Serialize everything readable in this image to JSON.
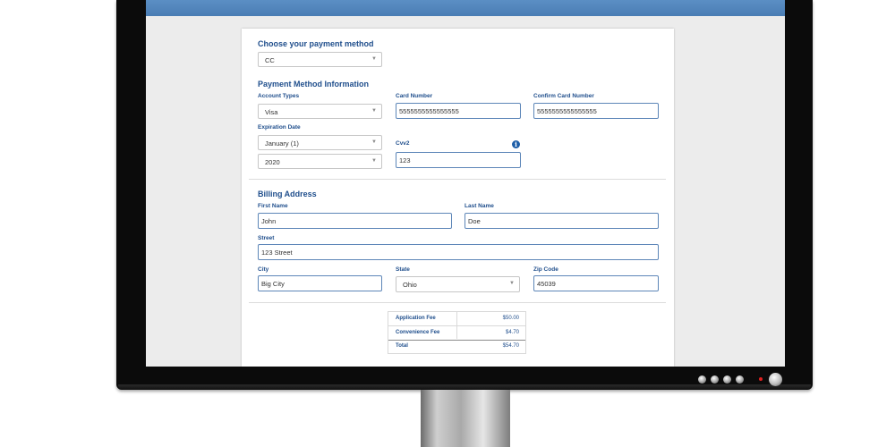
{
  "form": {
    "payment_method": {
      "heading": "Choose your payment method",
      "value": "CC"
    },
    "payment_info": {
      "heading": "Payment Method Information",
      "account_types": {
        "label": "Account Types",
        "value": "Visa"
      },
      "card_number": {
        "label": "Card Number",
        "value": "5555555555555555"
      },
      "confirm_card_number": {
        "label": "Confirm Card Number",
        "value": "5555555555555555"
      },
      "expiration": {
        "label": "Expiration Date",
        "month": "January (1)",
        "year": "2020"
      },
      "cvv": {
        "label": "Cvv2",
        "value": "123"
      }
    },
    "billing": {
      "heading": "Billing Address",
      "first_name": {
        "label": "First Name",
        "value": "John"
      },
      "last_name": {
        "label": "Last Name",
        "value": "Doe"
      },
      "street": {
        "label": "Street",
        "value": "123 Street"
      },
      "city": {
        "label": "City",
        "value": "Big City"
      },
      "state": {
        "label": "State",
        "value": "Ohio"
      },
      "zip": {
        "label": "Zip Code",
        "value": "45039"
      }
    },
    "fees": [
      {
        "name": "Application Fee",
        "amount": "$50.00"
      },
      {
        "name": "Convenience Fee",
        "amount": "$4.70"
      },
      {
        "name": "Total",
        "amount": "$54.70"
      }
    ]
  },
  "icons": {
    "info": "info-icon",
    "caret": "chevron-down-icon"
  },
  "colors": {
    "label_blue": "#1f4e8c",
    "input_border": "#5d86b8",
    "header_band": "#5b8fc4",
    "power_led": "#e02020"
  }
}
